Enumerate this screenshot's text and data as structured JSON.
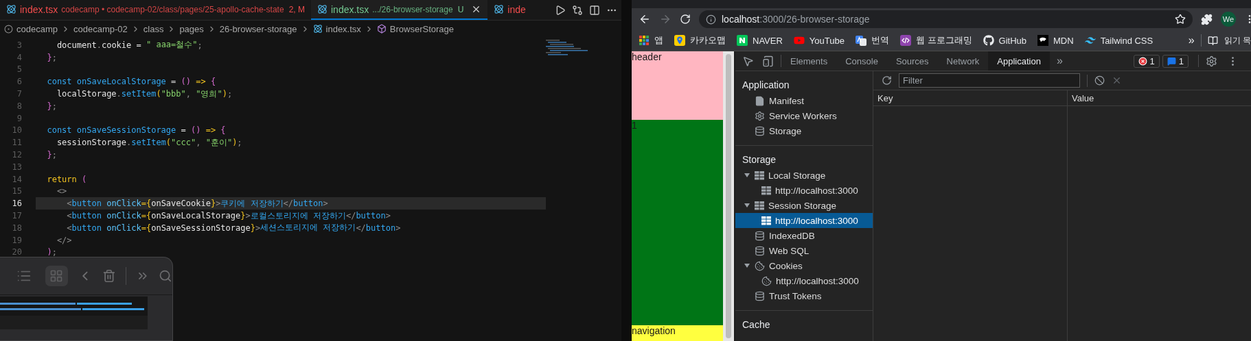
{
  "editor": {
    "tabs": [
      {
        "color": "#f14c4c",
        "label": "index.tsx",
        "path": "codecamp • codecamp-02/class/pages/25-apollo-cache-state",
        "status": "2, M",
        "selected": false
      },
      {
        "color": "#73c991",
        "label": "index.tsx",
        "path": ".../26-browser-storage",
        "status": "U",
        "selected": true
      },
      {
        "color": "#f14c4c",
        "label": "inde",
        "selected": false
      }
    ],
    "breadcrumb": [
      {
        "kind": "root",
        "label": "codecamp"
      },
      {
        "kind": "folder",
        "label": "codecamp-02"
      },
      {
        "kind": "folder",
        "label": "class"
      },
      {
        "kind": "folder",
        "label": "pages"
      },
      {
        "kind": "folder",
        "label": "26-browser-storage"
      },
      {
        "kind": "react",
        "label": "index.tsx"
      },
      {
        "kind": "component",
        "label": "BrowserStorage"
      }
    ],
    "lines": [
      {
        "number": "3",
        "current": false,
        "tokens": [
          {
            "kind": "id",
            "text": "    document"
          },
          {
            "kind": "gr",
            "text": "."
          },
          {
            "kind": "id",
            "text": "cookie = "
          },
          {
            "kind": "str",
            "text": "\" aaa=철수\""
          },
          {
            "kind": "gr",
            "text": ";"
          }
        ]
      },
      {
        "number": "4",
        "current": false,
        "tokens": [
          {
            "kind": "pk",
            "text": "  }"
          },
          {
            "kind": "gr",
            "text": ";"
          }
        ]
      },
      {
        "number": "5",
        "current": false
      },
      {
        "number": "6",
        "current": false,
        "tokens": [
          {
            "kind": "kw",
            "text": "  const "
          },
          {
            "kind": "fn",
            "text": "onSaveLocalStorage"
          },
          {
            "kind": "id",
            "text": " = "
          },
          {
            "kind": "pk",
            "text": "()"
          },
          {
            "kind": "yl",
            "text": " =>"
          },
          {
            "kind": "pk",
            "text": " {"
          }
        ]
      },
      {
        "number": "7",
        "current": false,
        "tokens": [
          {
            "kind": "id",
            "text": "    localStorage"
          },
          {
            "kind": "gr",
            "text": "."
          },
          {
            "kind": "fn",
            "text": "setItem"
          },
          {
            "kind": "yl",
            "text": "("
          },
          {
            "kind": "str",
            "text": "\"bbb\""
          },
          {
            "kind": "gr",
            "text": ", "
          },
          {
            "kind": "str",
            "text": "\"영희\""
          },
          {
            "kind": "yl",
            "text": ")"
          },
          {
            "kind": "gr",
            "text": ";"
          }
        ]
      },
      {
        "number": "8",
        "current": false,
        "tokens": [
          {
            "kind": "pk",
            "text": "  }"
          },
          {
            "kind": "gr",
            "text": ";"
          }
        ]
      },
      {
        "number": "9",
        "current": false
      },
      {
        "number": "10",
        "current": false,
        "tokens": [
          {
            "kind": "kw",
            "text": "  const "
          },
          {
            "kind": "fn",
            "text": "onSaveSessionStorage"
          },
          {
            "kind": "id",
            "text": " = "
          },
          {
            "kind": "pk",
            "text": "()"
          },
          {
            "kind": "yl",
            "text": " =>"
          },
          {
            "kind": "pk",
            "text": " {"
          }
        ]
      },
      {
        "number": "11",
        "current": false,
        "tokens": [
          {
            "kind": "id",
            "text": "    sessionStorage"
          },
          {
            "kind": "gr",
            "text": "."
          },
          {
            "kind": "fn",
            "text": "setItem"
          },
          {
            "kind": "yl",
            "text": "("
          },
          {
            "kind": "str",
            "text": "\"ccc\""
          },
          {
            "kind": "gr",
            "text": ", "
          },
          {
            "kind": "str",
            "text": "\"훈이\""
          },
          {
            "kind": "yl",
            "text": ")"
          },
          {
            "kind": "gr",
            "text": ";"
          }
        ]
      },
      {
        "number": "12",
        "current": false,
        "tokens": [
          {
            "kind": "pk",
            "text": "  }"
          },
          {
            "kind": "gr",
            "text": ";"
          }
        ]
      },
      {
        "number": "13",
        "current": false
      },
      {
        "number": "14",
        "current": false,
        "tokens": [
          {
            "kind": "yl",
            "text": "  return "
          },
          {
            "kind": "pk",
            "text": "("
          }
        ]
      },
      {
        "number": "15",
        "current": false,
        "tokens": [
          {
            "kind": "gr",
            "text": "    <>"
          }
        ]
      },
      {
        "number": "16",
        "current": true,
        "tokens": [
          {
            "kind": "gr",
            "text": "      <"
          },
          {
            "kind": "tag",
            "text": "button"
          },
          {
            "kind": "attr",
            "text": " onClick"
          },
          {
            "kind": "yl",
            "text": "={"
          },
          {
            "kind": "id",
            "text": "onSaveCookie"
          },
          {
            "kind": "yl",
            "text": "}"
          },
          {
            "kind": "gr",
            "text": ">"
          },
          {
            "kind": "txt",
            "text": "쿠키에 저장하기"
          },
          {
            "kind": "gr",
            "text": "</"
          },
          {
            "kind": "tag",
            "text": "button"
          },
          {
            "kind": "gr",
            "text": ">"
          }
        ]
      },
      {
        "number": "17",
        "current": false,
        "tokens": [
          {
            "kind": "gr",
            "text": "      <"
          },
          {
            "kind": "tag",
            "text": "button"
          },
          {
            "kind": "attr",
            "text": " onClick"
          },
          {
            "kind": "yl",
            "text": "={"
          },
          {
            "kind": "id",
            "text": "onSaveLocalStorage"
          },
          {
            "kind": "yl",
            "text": "}"
          },
          {
            "kind": "gr",
            "text": ">"
          },
          {
            "kind": "txt",
            "text": "로컬스토리지에 저장하기"
          },
          {
            "kind": "gr",
            "text": "</"
          },
          {
            "kind": "tag",
            "text": "button"
          },
          {
            "kind": "gr",
            "text": ">"
          }
        ]
      },
      {
        "number": "18",
        "current": false,
        "tokens": [
          {
            "kind": "gr",
            "text": "      <"
          },
          {
            "kind": "tag",
            "text": "button"
          },
          {
            "kind": "attr",
            "text": " onClick"
          },
          {
            "kind": "yl",
            "text": "={"
          },
          {
            "kind": "id",
            "text": "onSaveSessionStorage"
          },
          {
            "kind": "yl",
            "text": "}"
          },
          {
            "kind": "gr",
            "text": ">"
          },
          {
            "kind": "txt",
            "text": "세션스토리지에 저장하기"
          },
          {
            "kind": "gr",
            "text": "</"
          },
          {
            "kind": "tag",
            "text": "button"
          },
          {
            "kind": "gr",
            "text": ">"
          }
        ]
      },
      {
        "number": "19",
        "current": false,
        "tokens": [
          {
            "kind": "gr",
            "text": "    </>"
          }
        ]
      },
      {
        "number": "20",
        "current": false,
        "tokens": [
          {
            "kind": "pk",
            "text": "  )"
          },
          {
            "kind": "gr",
            "text": ";"
          }
        ]
      }
    ],
    "clipboard_panel": {
      "view_buttons": [
        {
          "kind": "list",
          "selected": false
        },
        {
          "kind": "grid",
          "selected": true
        }
      ]
    }
  },
  "browser": {
    "forward": {
      "disabled": true
    },
    "address": {
      "host": "localhost",
      "path": ":3000/26-browser-storage"
    },
    "profile": "We",
    "bookmarks": [
      {
        "kind": "apps",
        "label": "앱"
      },
      {
        "kind": "map",
        "label": "카카오맵"
      },
      {
        "kind": "naver",
        "label": "NAVER"
      },
      {
        "kind": "youtube",
        "label": "YouTube"
      },
      {
        "kind": "translate",
        "label": "번역"
      },
      {
        "kind": "code",
        "label": "웹 프로그래밍"
      },
      {
        "kind": "github",
        "label": "GitHub"
      },
      {
        "kind": "mdn",
        "label": "MDN"
      },
      {
        "kind": "tailwind",
        "label": "Tailwind CSS"
      }
    ],
    "more": "»",
    "reading_list": "읽기 목"
  },
  "page": {
    "sections": [
      {
        "label": "header",
        "color": "#ffb6c1"
      },
      {
        "label": "1",
        "color": "#007516"
      },
      {
        "label": "navigation",
        "color": "#ffff3f"
      }
    ]
  },
  "devtools": {
    "tabs": [
      {
        "label": "Elements",
        "selected": false
      },
      {
        "label": "Console",
        "selected": false
      },
      {
        "label": "Sources",
        "selected": false
      },
      {
        "label": "Network",
        "selected": false
      },
      {
        "label": "Application",
        "selected": true
      }
    ],
    "more": "»",
    "errors": "1",
    "messages": "1",
    "sidebar": [
      {
        "title": "Application",
        "items": [
          {
            "kind": "file",
            "label": "Manifest",
            "selected": false
          },
          {
            "kind": "gear",
            "label": "Service Workers",
            "selected": false
          },
          {
            "kind": "database",
            "label": "Storage",
            "selected": false
          }
        ]
      },
      {
        "title": "Storage",
        "items": [
          {
            "kind": "table",
            "label": "Local Storage",
            "selected": false,
            "expanded": true,
            "children": [
              {
                "kind": "table",
                "label": "http://localhost:3000",
                "selected": false
              }
            ]
          },
          {
            "kind": "table",
            "label": "Session Storage",
            "selected": false,
            "expanded": true,
            "children": [
              {
                "kind": "table",
                "label": "http://localhost:3000",
                "selected": true
              }
            ]
          },
          {
            "kind": "database",
            "label": "IndexedDB",
            "selected": false
          },
          {
            "kind": "database",
            "label": "Web SQL",
            "selected": false
          },
          {
            "kind": "cookie",
            "label": "Cookies",
            "selected": false,
            "expanded": true,
            "children": [
              {
                "kind": "cookie",
                "label": "http://localhost:3000",
                "selected": false
              }
            ]
          },
          {
            "kind": "database",
            "label": "Trust Tokens",
            "selected": false
          }
        ]
      },
      {
        "title": "Cache"
      }
    ],
    "filter": {
      "placeholder": "Filter"
    },
    "columns": [
      "Key",
      "Value"
    ]
  }
}
